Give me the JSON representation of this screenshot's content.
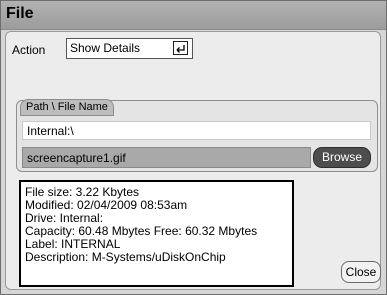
{
  "window": {
    "title": "File"
  },
  "action": {
    "label": "Action",
    "value": "Show Details",
    "enter_icon": "enter-return-icon"
  },
  "path_group": {
    "label": "Path \\ File Name",
    "path": "Internal:\\",
    "file_name": "screencapture1.gif",
    "browse_label": "Browse"
  },
  "details": {
    "file_size": "File size: 3.22 Kbytes",
    "modified": "Modified: 02/04/2009  08:53am",
    "drive": "Drive: Internal:",
    "capacity": "Capacity: 60.48 Mbytes    Free: 60.32 Mbytes",
    "label": "Label: INTERNAL",
    "description": "Description: M-Systems/uDiskOnChip"
  },
  "buttons": {
    "close_label": "Close"
  }
}
